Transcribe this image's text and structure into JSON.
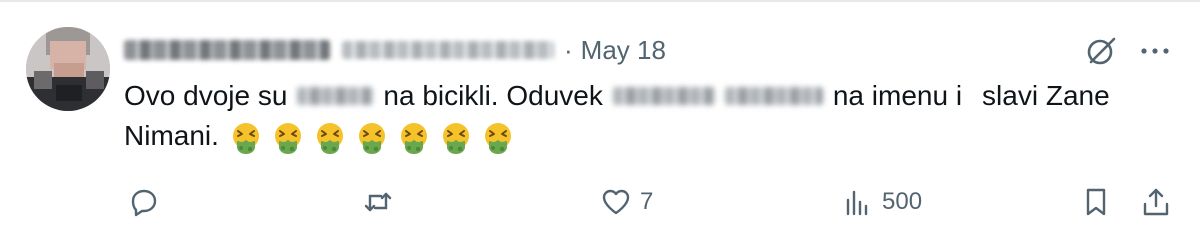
{
  "tweet": {
    "date": "May 18",
    "separator": "·",
    "text_parts": {
      "p1": "Ovo dvoje su",
      "p2": "na bicikli. Oduvek",
      "p3": "na imenu i",
      "p4": "slavi Zane",
      "p5": "Nimani."
    },
    "emoji": "🤮",
    "emoji_count": 7,
    "colors": {
      "text": "#0f1419",
      "secondary": "#536471",
      "emoji_face": "#f5c22a",
      "emoji_vomit": "#6aa84f"
    }
  },
  "actions": {
    "reply": {
      "icon": "reply-icon",
      "count": ""
    },
    "retweet": {
      "icon": "retweet-icon",
      "count": ""
    },
    "like": {
      "icon": "heart-icon",
      "count": "7"
    },
    "views": {
      "icon": "analytics-icon",
      "count": "500"
    },
    "bookmark": {
      "icon": "bookmark-icon"
    },
    "share": {
      "icon": "share-icon"
    }
  },
  "header_icons": {
    "grok": "grok-icon",
    "more": "more-icon"
  }
}
